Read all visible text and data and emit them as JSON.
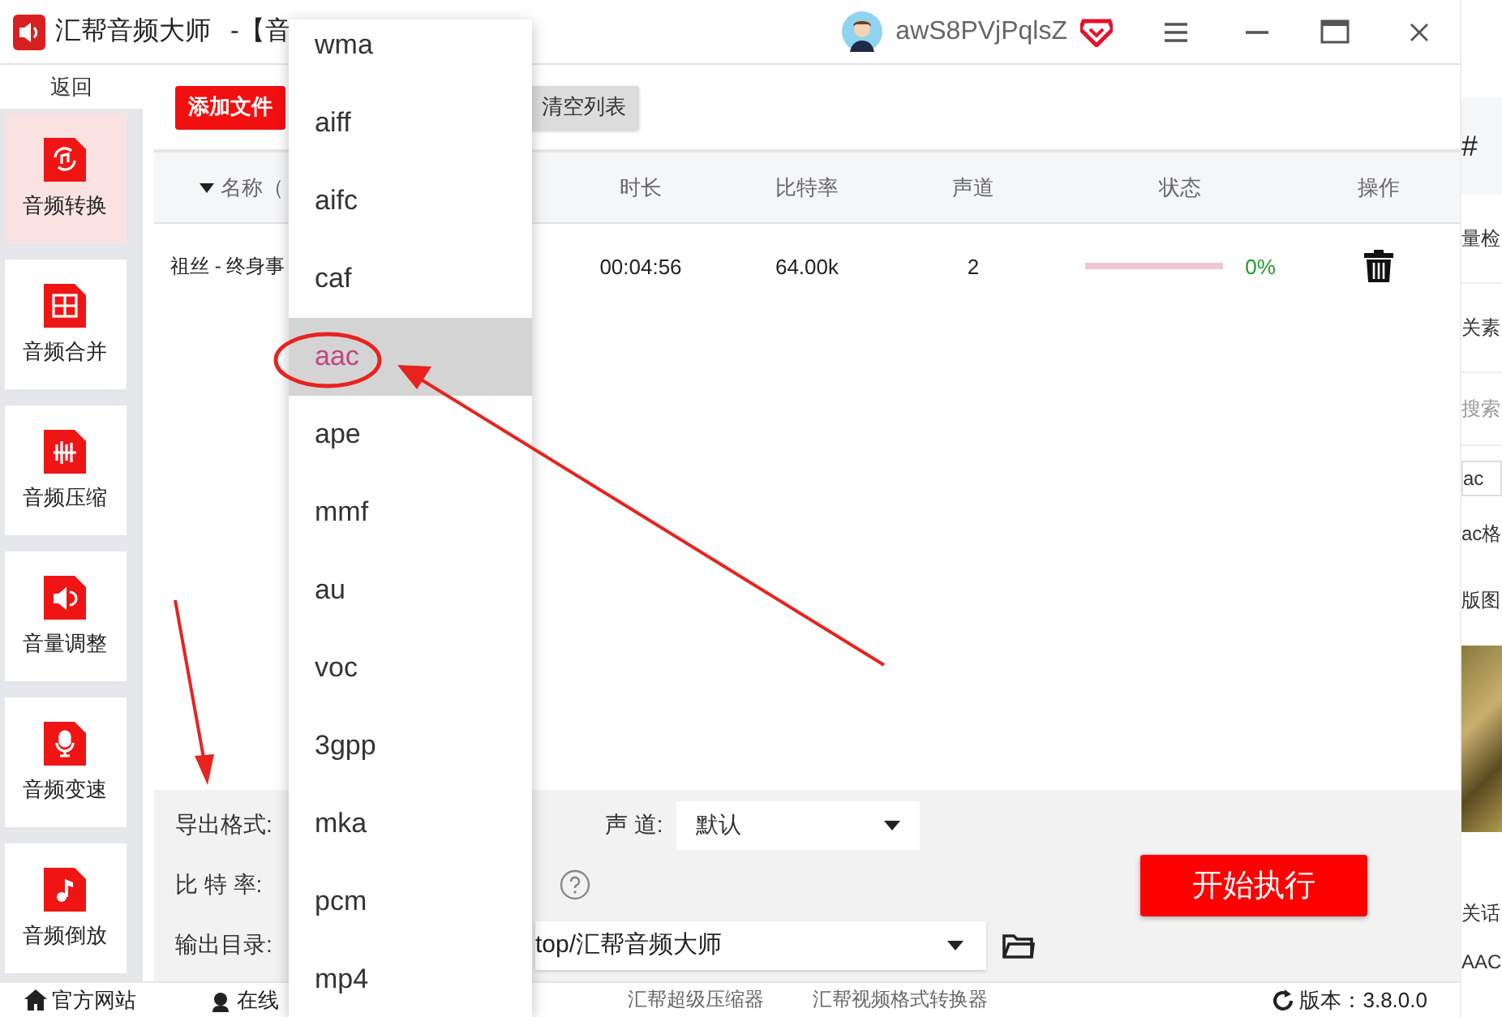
{
  "window": {
    "title": "汇帮音频大师",
    "subtitle": "-【音"
  },
  "user": {
    "name": "awS8PVjPqlsZ"
  },
  "sidebar": {
    "back": "返回",
    "items": [
      {
        "label": "音频转换",
        "selected": true
      },
      {
        "label": "音频合并",
        "selected": false
      },
      {
        "label": "音频压缩",
        "selected": false
      },
      {
        "label": "音量调整",
        "selected": false
      },
      {
        "label": "音频变速",
        "selected": false
      },
      {
        "label": "音频倒放",
        "selected": false
      }
    ]
  },
  "toolbar": {
    "buttons": [
      {
        "label": "添加文件",
        "kind": "primary"
      },
      {
        "label": "清空列表",
        "kind": "secondary"
      }
    ]
  },
  "table": {
    "columns": [
      "名称（",
      "时长",
      "比特率",
      "声道",
      "状态",
      "操作"
    ],
    "rows": [
      {
        "name": "祖丝 - 终身事",
        "duration": "00:04:56",
        "bitrate": "64.00k",
        "channels": "2",
        "level": 0,
        "percent": "0%"
      }
    ]
  },
  "settings": {
    "format_label": "导出格式:",
    "channel_label": "声 道:",
    "channel_value": "默认",
    "bitrate_label": "比 特 率:",
    "output_label": "输出目录:",
    "output_value": "top/汇帮音频大师",
    "start_button": "开始执行"
  },
  "dropdown": {
    "options": [
      {
        "label": "wma",
        "selected": false
      },
      {
        "label": "aiff",
        "selected": false
      },
      {
        "label": "aifc",
        "selected": false
      },
      {
        "label": "caf",
        "selected": false
      },
      {
        "label": "aac",
        "selected": true
      },
      {
        "label": "ape",
        "selected": false
      },
      {
        "label": "mmf",
        "selected": false
      },
      {
        "label": "au",
        "selected": false
      },
      {
        "label": "voc",
        "selected": false
      },
      {
        "label": "3gpp",
        "selected": false
      },
      {
        "label": "mka",
        "selected": false
      },
      {
        "label": "pcm",
        "selected": false
      },
      {
        "label": "mp4",
        "selected": false
      }
    ]
  },
  "footer": {
    "links": [
      "官方网站",
      "在线",
      "汇帮超级压缩器",
      "汇帮视频格式转换器"
    ],
    "version": "版本：3.8.0.0"
  },
  "web_strip": {
    "items": [
      {
        "kind": "heading",
        "text": "#"
      },
      {
        "kind": "text",
        "text": "量检"
      },
      {
        "kind": "text",
        "text": "关素"
      },
      {
        "kind": "placeholder",
        "text": "搜索"
      },
      {
        "kind": "input",
        "text": "ac"
      },
      {
        "kind": "text",
        "text": "ac格"
      },
      {
        "kind": "text",
        "text": "版图"
      },
      {
        "kind": "photo"
      },
      {
        "kind": "text",
        "text": "关话"
      },
      {
        "kind": "text",
        "text": "AAC"
      }
    ]
  }
}
